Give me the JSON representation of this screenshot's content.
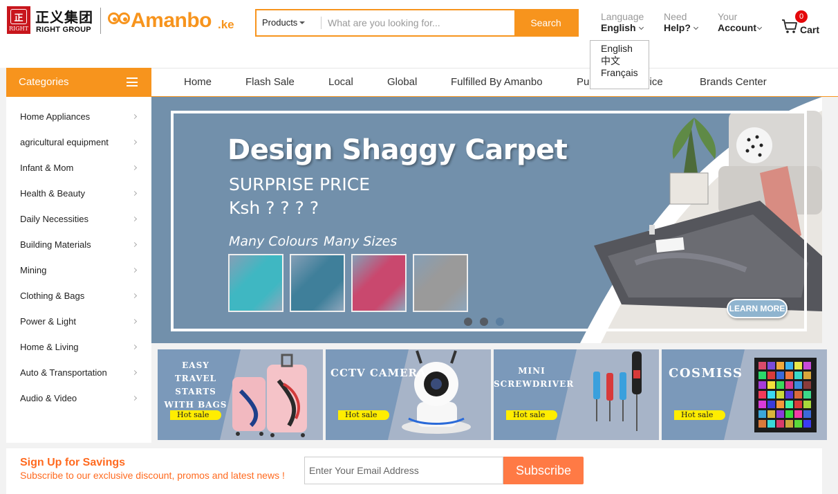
{
  "header": {
    "group_logo_cn": "正义集团",
    "group_logo_en": "RIGHT GROUP",
    "seal_text": "RIGHT",
    "brand": "Amanbo",
    "brand_tld": ".ke",
    "search": {
      "category": "Products",
      "placeholder": "What are you looking for...",
      "button": "Search"
    },
    "language": {
      "label": "Language",
      "value": "English"
    },
    "help": {
      "label": "Need",
      "value": "Help?"
    },
    "account": {
      "label": "Your",
      "value": "Account"
    },
    "cart": {
      "label": "Cart",
      "count": "0"
    },
    "language_options": [
      "English",
      "中文",
      "Français"
    ]
  },
  "categories_button": "Categories",
  "nav": [
    "Home",
    "Flash Sale",
    "Local",
    "Global",
    "Fulfilled By Amanbo",
    "Pu",
    "vice",
    "Brands Center"
  ],
  "categories": [
    "Home Appliances",
    "agricultural equipment",
    "Infant & Mom",
    "Health & Beauty",
    "Daily Necessities",
    "Building Materials",
    "Mining",
    "Clothing & Bags",
    "Power & Light",
    "Home & Living",
    "Auto & Transportation",
    "Audio & Video"
  ],
  "banner": {
    "title": "Design Shaggy Carpet",
    "subtitle": "SURPRISE PRICE",
    "price": "Ksh ? ? ? ?",
    "feature_1": "Many Colours",
    "feature_2": "Many Sizes",
    "cta": "LEARN MORE",
    "swatch_colors": [
      "#3fb7c2",
      "#3f7f9a",
      "#c9486e",
      "#9a9a9a"
    ],
    "slides": 3,
    "active_slide": 3
  },
  "promos": [
    {
      "title_lines": [
        "EASY TRAVEL",
        "STARTS",
        "WITH BAGS"
      ],
      "badge": "Hot sale",
      "icon": "luggage-icon"
    },
    {
      "title_lines": [
        "CCTV CAMERA"
      ],
      "badge": "Hot sale",
      "icon": "camera-icon"
    },
    {
      "title_lines": [
        "MINI",
        "SCREWDRIVER"
      ],
      "badge": "Hot sale",
      "icon": "screwdriver-icon"
    },
    {
      "title_lines": [
        "COSMISS"
      ],
      "badge": "Hot sale",
      "icon": "palette-icon"
    }
  ],
  "signup": {
    "title": "Sign Up for Savings",
    "subtitle": "Subscribe to our exclusive discount, promos and latest news !",
    "placeholder": "Enter Your Email Address",
    "button": "Subscribe"
  },
  "colors": {
    "accent": "#f7941d",
    "banner_bg": "#7290ab",
    "tile_bg": "#7b99ba",
    "badge_yellow": "#ffed00",
    "cart_badge": "#e4080a",
    "subscribe": "#ff7a45"
  }
}
